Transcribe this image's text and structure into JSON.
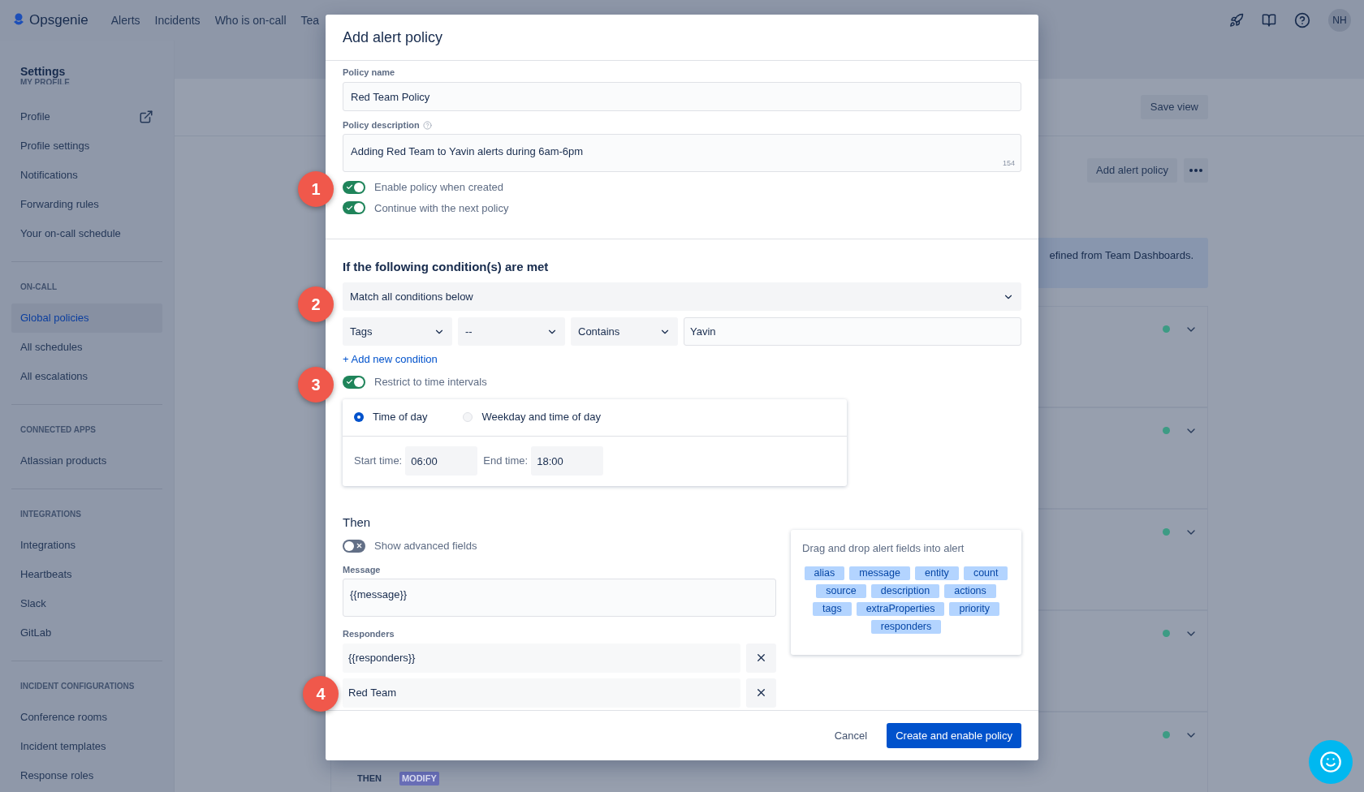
{
  "nav": {
    "brand": "Opsgenie",
    "items": [
      "Alerts",
      "Incidents",
      "Who is on-call",
      "Tea"
    ],
    "avatar": "NH"
  },
  "sidebar": {
    "title": "Settings",
    "sections": [
      {
        "heading": "MY PROFILE",
        "items": [
          {
            "label": "Profile",
            "selected": false,
            "external": true
          },
          {
            "label": "Profile settings",
            "selected": false,
            "external": false
          },
          {
            "label": "Notifications",
            "selected": false,
            "external": false
          },
          {
            "label": "Forwarding rules",
            "selected": false,
            "external": false
          },
          {
            "label": "Your on-call schedule",
            "selected": false,
            "external": false
          }
        ]
      },
      {
        "heading": "ON-CALL",
        "items": [
          {
            "label": "Global policies",
            "selected": true,
            "external": false
          },
          {
            "label": "All schedules",
            "selected": false,
            "external": false
          },
          {
            "label": "All escalations",
            "selected": false,
            "external": false
          }
        ]
      },
      {
        "heading": "CONNECTED APPS",
        "items": [
          {
            "label": "Atlassian products",
            "selected": false,
            "external": false
          }
        ]
      },
      {
        "heading": "INTEGRATIONS",
        "items": [
          {
            "label": "Integrations",
            "selected": false,
            "external": false
          },
          {
            "label": "Heartbeats",
            "selected": false,
            "external": false
          },
          {
            "label": "Slack",
            "selected": false,
            "external": false
          },
          {
            "label": "GitLab",
            "selected": false,
            "external": false
          }
        ]
      },
      {
        "heading": "INCIDENT CONFIGURATIONS",
        "items": [
          {
            "label": "Conference rooms",
            "selected": false,
            "external": false
          },
          {
            "label": "Incident templates",
            "selected": false,
            "external": false
          },
          {
            "label": "Response roles",
            "selected": false,
            "external": false
          }
        ]
      }
    ]
  },
  "background": {
    "save_view": "Save view",
    "add_button": "Add alert policy",
    "banner": "efined from Team Dashboards.",
    "policy_cards": [
      {
        "enabled": true
      },
      {
        "enabled": true
      },
      {
        "enabled": true
      },
      {
        "enabled": true
      },
      {
        "enabled": true
      }
    ],
    "then_label": "THEN",
    "action_tag": "MODIFY"
  },
  "modal": {
    "title": "Add alert policy",
    "policy_name": {
      "label": "Policy name",
      "value": "Red Team Policy"
    },
    "description": {
      "label": "Policy description",
      "value": "Adding Red Team to Yavin alerts during 6am-6pm",
      "counter": "154"
    },
    "toggles": [
      {
        "label": "Enable policy when created",
        "on": true
      },
      {
        "label": "Continue with the next policy",
        "on": true
      }
    ],
    "conditions": {
      "heading": "If the following condition(s) are met",
      "match": "Match all conditions below",
      "field": "Tags",
      "selector": "--",
      "operator": "Contains",
      "value": "Yavin",
      "add_link": "+ Add new condition"
    },
    "time_restriction": {
      "label": "Restrict to time intervals",
      "on": true,
      "options": [
        {
          "label": "Time of day",
          "selected": true
        },
        {
          "label": "Weekday and time of day",
          "selected": false
        }
      ],
      "start_label": "Start time:",
      "start": "06:00",
      "end_label": "End time:",
      "end": "18:00"
    },
    "then": {
      "heading": "Then",
      "advanced": {
        "label": "Show advanced fields",
        "on": false
      },
      "message_label": "Message",
      "message": "{{message}}",
      "responders_label": "Responders",
      "responders": [
        "{{responders}}",
        "Red Team"
      ]
    },
    "fields_panel": {
      "title": "Drag and drop alert fields into alert",
      "tags": [
        "alias",
        "message",
        "entity",
        "count",
        "source",
        "description",
        "actions",
        "tags",
        "extraProperties",
        "priority",
        "responders"
      ]
    },
    "cancel": "Cancel",
    "submit": "Create and enable policy"
  },
  "callouts": [
    "1",
    "2",
    "3",
    "4"
  ]
}
